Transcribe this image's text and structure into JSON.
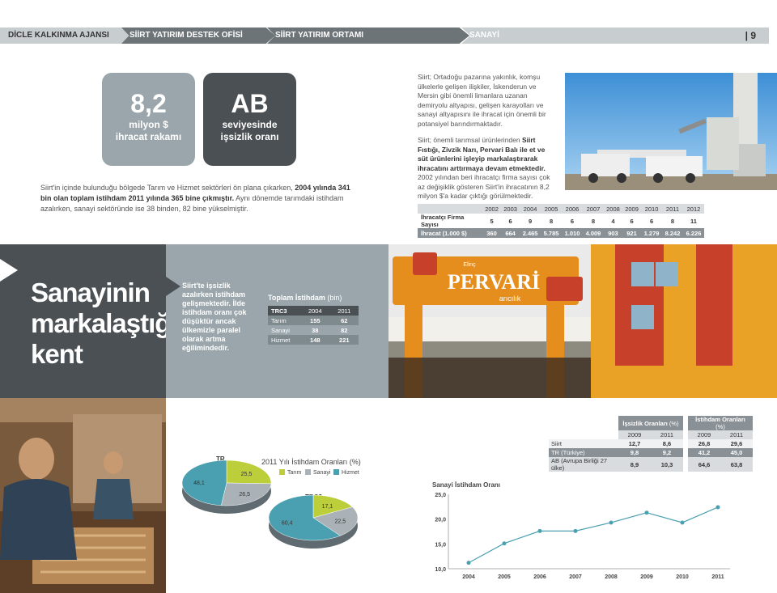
{
  "header": {
    "seg1": "DİCLE KALKINMA AJANSI",
    "seg2": "SİİRT YATIRIM DESTEK OFİSİ",
    "seg3": "SİİRT YATIRIM ORTAMI",
    "seg4": "SANAYİ",
    "page": "| 9"
  },
  "stats": {
    "box1_big": "8,2",
    "box1_line1": "milyon $",
    "box1_line2": "ihracat rakamı",
    "box2_big": "AB",
    "box2_line1": "seviyesinde",
    "box2_line2": "işsizlik oranı",
    "box1_color": "#9aa6ab",
    "box2_color": "#4a5053"
  },
  "intro": {
    "p1": "Siirt'in içinde bulunduğu bölgede Tarım ve Hizmet sektörleri ön plana çıkarken, ",
    "b1": "2004 yılında 341 bin olan toplam istihdam 2011 yılında 365 bine çıkmıştır.",
    "p2": " Aynı dönemde tarımdaki istihdam azalırken, sanayi sektöründe ise 38 binden, 82 bine yükselmiştir."
  },
  "right_text": {
    "p1": "Siirt; Ortadoğu pazarına yakınlık, komşu ülkelerle gelişen ilişkiler, İskenderun ve Mersin gibi önemli limanlara uzanan demiryolu altyapısı, gelişen karayolları ve sanayi altyapısını ile ihracat için önemli bir potansiyel barındırmaktadır.",
    "p2a": "Siirt; önemli tarımsal ürünlerinden ",
    "p2b": "Siirt Fıstığı, Zivzik Narı, Pervari Balı ile et ve süt ürünlerini işleyip markalaştırarak ihracatını arttırmaya devam etmektedir.",
    "p2c": " 2002 yılından beri ihracatçı firma sayısı çok az değişiklik gösteren Siirt'in ihracatının 8,2 milyon $'a kadar çıktığı görülmektedir."
  },
  "export_table": {
    "years": [
      "2002",
      "2003",
      "2004",
      "2005",
      "2006",
      "2007",
      "2008",
      "2009",
      "2010",
      "2011",
      "2012"
    ],
    "rows": [
      {
        "label": "İhracatçı Firma Sayısı",
        "values": [
          "5",
          "6",
          "9",
          "8",
          "6",
          "8",
          "4",
          "6",
          "6",
          "8",
          "11"
        ]
      },
      {
        "label": "İhracat (1.000 $)",
        "values": [
          "360",
          "664",
          "2.465",
          "5.785",
          "1.010",
          "4.009",
          "903",
          "921",
          "1.279",
          "8.242",
          "6.226"
        ]
      }
    ]
  },
  "band": {
    "headline1": "Sanayinin",
    "headline2": "markalaştığı",
    "headline3": "kent",
    "quote": "Siirt'te işsizlik azalırken istihdam gelişmektedir. İlde istihdam oranı çok düşüktür ancak ülkemizle paralel olarak artma eğilimindedir.",
    "emp_title": "Toplam İstihdam",
    "emp_unit": " (bin)",
    "emp_head": [
      "TRC3",
      "2004",
      "2011"
    ],
    "emp_rows": [
      [
        "Tarım",
        "155",
        "62"
      ],
      [
        "Sanayi",
        "38",
        "82"
      ],
      [
        "Hizmet",
        "148",
        "221"
      ]
    ],
    "sign1": "PERVARİ",
    "sign2": "arıcılık",
    "sign3": "Elinç"
  },
  "pies": {
    "title": "2011 Yılı İstihdam Oranları",
    "unit": " (%)",
    "legend": [
      "Tarım",
      "Sanayi",
      "Hizmet"
    ],
    "colors": {
      "tarim": "#bccf3a",
      "sanayi": "#aab2b7",
      "hizmet": "#4aa0b0"
    },
    "tr_label": "TR",
    "tr_values": [
      "48,1",
      "25,5",
      "26,5"
    ],
    "trc3_label": "TRC3",
    "trc3_values": [
      "17,1",
      "22,5",
      "60,4"
    ]
  },
  "unemp_table": {
    "g1": "İşsizlik Oranları",
    "g2": "İstihdam Oranları",
    "unit": " (%)",
    "years": [
      "2009",
      "2011",
      "2009",
      "2011"
    ],
    "rows": [
      {
        "label": "Siirt",
        "values": [
          "12,7",
          "8,6",
          "26,8",
          "29,6"
        ]
      },
      {
        "label": "TR (Türkiye)",
        "values": [
          "9,8",
          "9,2",
          "41,2",
          "45,0"
        ]
      },
      {
        "label": "AB (Avrupa Birliği 27 ülke)",
        "values": [
          "8,9",
          "10,3",
          "64,6",
          "63,8"
        ]
      }
    ]
  },
  "chart_data": {
    "type": "line",
    "title": "Sanayi İstihdam Oranı",
    "x": [
      "2004",
      "2005",
      "2006",
      "2007",
      "2008",
      "2009",
      "2010",
      "2011"
    ],
    "series": [
      {
        "values": [
          11.2,
          15.1,
          17.6,
          17.6,
          19.3,
          21.3,
          19.3,
          22.4
        ]
      }
    ],
    "ylim": [
      10,
      25
    ],
    "yticks": [
      "25,0",
      "20,0",
      "15,0",
      "10,0"
    ],
    "color": "#4aa0b0",
    "grid": false
  }
}
